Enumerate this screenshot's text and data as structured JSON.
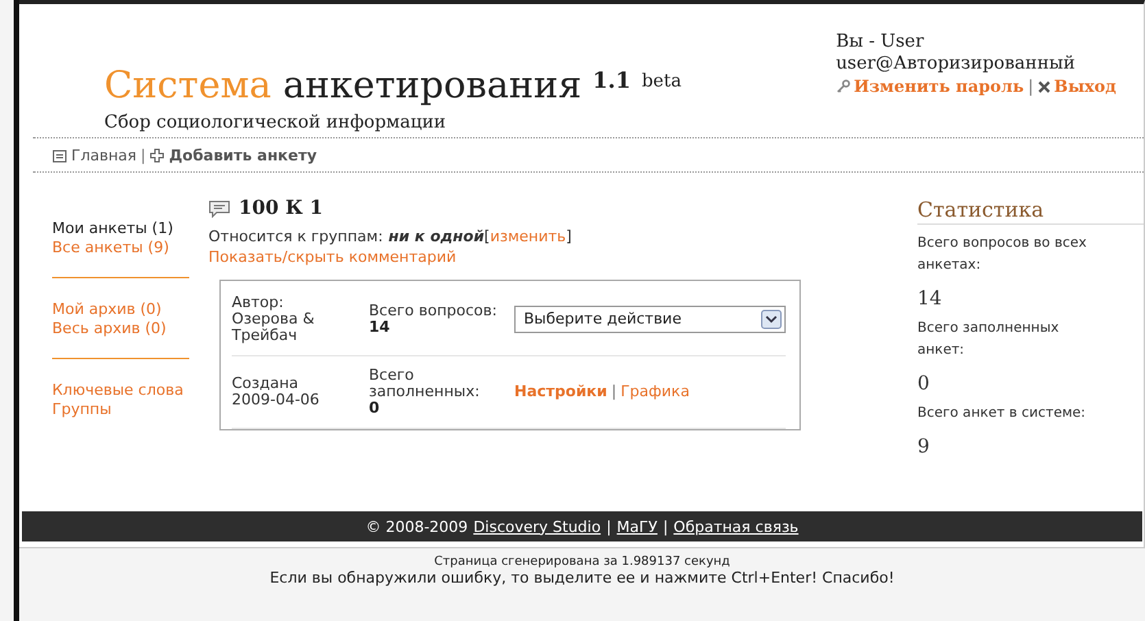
{
  "header": {
    "title_accent": "Система",
    "title_rest": "анкетирования",
    "version": "1.1",
    "version_tag": "beta",
    "subtitle": "Сбор социологической информации",
    "user_line": "Вы - User",
    "user_status": "user@Авторизированный",
    "change_password": "Изменить пароль",
    "separator": "|",
    "logout": "Выход"
  },
  "nav": {
    "home": "Главная",
    "separator": "|",
    "add": "Добавить анкету"
  },
  "sidebar": {
    "groups": [
      {
        "items": [
          {
            "label": "Мои анкеты (1)",
            "selected": true
          },
          {
            "label": "Все анкеты (9)",
            "selected": false
          }
        ]
      },
      {
        "items": [
          {
            "label": "Мой архив (0)",
            "selected": false
          },
          {
            "label": "Весь архив (0)",
            "selected": false
          }
        ]
      },
      {
        "items": [
          {
            "label": "Ключевые слова",
            "selected": false
          },
          {
            "label": "Группы",
            "selected": false
          }
        ]
      }
    ]
  },
  "survey": {
    "title": "100 К 1",
    "groups_label": "Относится к группам:",
    "groups_value": "ни к одной",
    "change_open": "[",
    "change_link": "изменить",
    "change_close": "]",
    "toggle_comment": "Показать/скрыть комментарий",
    "author_label": "Автор:",
    "author": "Озерова & Трейбач",
    "questions_label": "Всего вопросов:",
    "questions": "14",
    "action_placeholder": "Выберите действие",
    "created_label": "Создана",
    "created": "2009-04-06",
    "filled_label": "Всего заполненных:",
    "filled": "0",
    "settings": "Настройки",
    "separator": "|",
    "graphics": "Графика"
  },
  "stats": {
    "title": "Статистика",
    "items": [
      {
        "label": "Всего вопросов во всех анкетах:",
        "value": "14"
      },
      {
        "label": "Всего заполненных анкет:",
        "value": "0"
      },
      {
        "label": "Всего анкет в системе:",
        "value": "9"
      }
    ]
  },
  "footer": {
    "copyright": "© 2008-2009",
    "links": [
      "Discovery Studio",
      "МаГУ",
      "Обратная связь"
    ],
    "separator": "|",
    "generated": "Страница сгенерирована за 1.989137 секунд",
    "hint": "Если вы обнаружили ошибку, то выделите ее и нажмите Ctrl+Enter! Спасибо!"
  }
}
